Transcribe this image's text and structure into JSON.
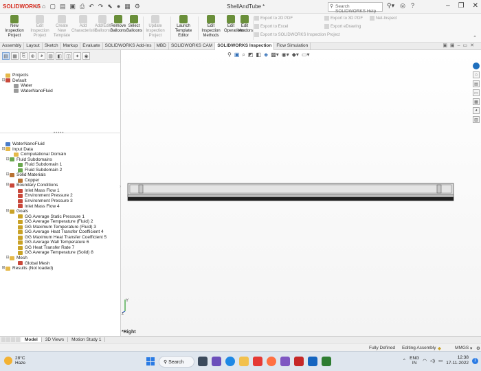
{
  "titlebar": {
    "logo": "SOLIDWORKS",
    "doc_title": "ShellAndTube *",
    "search_placeholder": "Search SOLIDWORKS Help",
    "min": "–",
    "max": "❐",
    "close": "✕"
  },
  "ribbon": {
    "buttons": [
      {
        "l1": "New Inspection",
        "l2": "Project",
        "enabled": true
      },
      {
        "l1": "Edit Inspection",
        "l2": "Project",
        "enabled": false
      },
      {
        "l1": "Create New",
        "l2": "Template",
        "enabled": false
      },
      {
        "l1": "Add",
        "l2": "Characteristic",
        "enabled": false
      },
      {
        "l1": "Add/Edit",
        "l2": "Balloons",
        "enabled": false
      },
      {
        "l1": "Remove",
        "l2": "Balloons",
        "enabled": true
      },
      {
        "l1": "Select",
        "l2": "Balloons",
        "enabled": true
      },
      {
        "l1": "Update Inspection",
        "l2": "Project",
        "enabled": false
      },
      {
        "l1": "Launch",
        "l2": "Template Editor",
        "enabled": true
      },
      {
        "l1": "Edit Inspection",
        "l2": "Methods",
        "enabled": true
      },
      {
        "l1": "Edit",
        "l2": "Operations",
        "enabled": true
      },
      {
        "l1": "Edit",
        "l2": "Vendors",
        "enabled": true
      }
    ],
    "export_2d_pdf": "Export to 2D PDF",
    "export_excel": "Export to Excel",
    "export_sw_project": "Export to SOLIDWORKS Inspection Project",
    "export_3d_pdf": "Export to 3D PDF",
    "export_edrawing": "Export eDrawing",
    "net_inspect": "Net-Inspect"
  },
  "tabs": [
    "Assembly",
    "Layout",
    "Sketch",
    "Markup",
    "Evaluate",
    "SOLIDWORKS Add-Ins",
    "MBD",
    "SOLIDWORKS CAM",
    "SOLIDWORKS Inspection",
    "Flow Simulation"
  ],
  "active_tab": "SOLIDWORKS Inspection",
  "tree_top": [
    {
      "label": "Projects",
      "indent": 0,
      "exp": "",
      "icon": "folder"
    },
    {
      "label": "Default",
      "indent": 0,
      "exp": "⊟",
      "icon": "red"
    },
    {
      "label": "Water",
      "indent": 2,
      "exp": "",
      "icon": "grey"
    },
    {
      "label": "WaterNanoFluid",
      "indent": 2,
      "exp": "",
      "icon": "grey"
    }
  ],
  "tree_flow": [
    {
      "label": "WaterNanoFluid",
      "indent": 0,
      "exp": "",
      "icon": "blue"
    },
    {
      "label": "Input Data",
      "indent": 0,
      "exp": "⊟",
      "icon": "folder"
    },
    {
      "label": "Computational Domain",
      "indent": 2,
      "exp": "",
      "icon": "folder"
    },
    {
      "label": "Fluid Subdomains",
      "indent": 1,
      "exp": "⊟",
      "icon": "green"
    },
    {
      "label": "Fluid Subdomain 1",
      "indent": 3,
      "exp": "",
      "icon": "green"
    },
    {
      "label": "Fluid Subdomain 2",
      "indent": 3,
      "exp": "",
      "icon": "green"
    },
    {
      "label": "Solid Materials",
      "indent": 1,
      "exp": "⊟",
      "icon": "cu"
    },
    {
      "label": "Copper",
      "indent": 3,
      "exp": "",
      "icon": "cu"
    },
    {
      "label": "Boundary Conditions",
      "indent": 1,
      "exp": "⊟",
      "icon": "red"
    },
    {
      "label": "Inlet Mass Flow 1",
      "indent": 3,
      "exp": "",
      "icon": "red"
    },
    {
      "label": "Environment Pressure 2",
      "indent": 3,
      "exp": "",
      "icon": "red"
    },
    {
      "label": "Environment Pressure 3",
      "indent": 3,
      "exp": "",
      "icon": "red"
    },
    {
      "label": "Inlet Mass Flow 4",
      "indent": 3,
      "exp": "",
      "icon": "red"
    },
    {
      "label": "Goals",
      "indent": 1,
      "exp": "⊟",
      "icon": "goal"
    },
    {
      "label": "GG Average Static Pressure 1",
      "indent": 3,
      "exp": "",
      "icon": "goal"
    },
    {
      "label": "GG Average Temperature (Fluid) 2",
      "indent": 3,
      "exp": "",
      "icon": "goal"
    },
    {
      "label": "GG Maximum Temperature (Fluid) 3",
      "indent": 3,
      "exp": "",
      "icon": "goal"
    },
    {
      "label": "GG Average Heat Transfer Coefficient 4",
      "indent": 3,
      "exp": "",
      "icon": "goal"
    },
    {
      "label": "GG Maximum Heat Transfer Coefficient 5",
      "indent": 3,
      "exp": "",
      "icon": "goal"
    },
    {
      "label": "GG Average Wall Temperature 6",
      "indent": 3,
      "exp": "",
      "icon": "goal"
    },
    {
      "label": "GG Heat Transfer Rate 7",
      "indent": 3,
      "exp": "",
      "icon": "goal"
    },
    {
      "label": "GG Average Temperature (Solid) 8",
      "indent": 3,
      "exp": "",
      "icon": "goal"
    },
    {
      "label": "Mesh",
      "indent": 1,
      "exp": "⊟",
      "icon": "folder"
    },
    {
      "label": "Global Mesh",
      "indent": 3,
      "exp": "",
      "icon": "red"
    },
    {
      "label": "Results (Not loaded)",
      "indent": 0,
      "exp": "⊞",
      "icon": "folder"
    }
  ],
  "graphics": {
    "view_label": "*Right",
    "triad_y": "Y",
    "triad_z": "Z"
  },
  "bottom_tabs": [
    "Model",
    "3D Views",
    "Motion Study 1"
  ],
  "active_bottom_tab": "Model",
  "status": {
    "fully_defined": "Fully Defined",
    "editing": "Editing Assembly",
    "units": "MMGS"
  },
  "taskbar": {
    "temp": "28°C",
    "weather": "Haze",
    "search": "Search",
    "lang1": "ENG",
    "lang2": "IN",
    "time": "12:38",
    "date": "17-11-2022",
    "notif": "1"
  }
}
